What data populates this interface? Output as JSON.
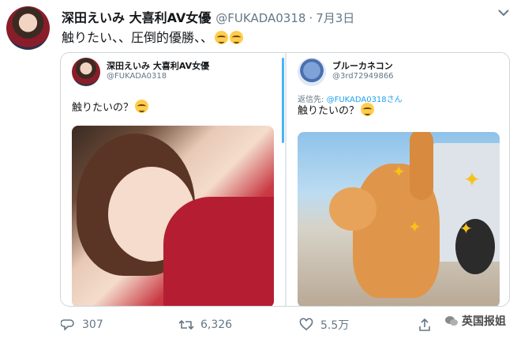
{
  "tweet": {
    "author_name": "深田えいみ 大喜利AV女優",
    "author_handle": "@FUKADA0318",
    "date": "7月3日",
    "dot": "·",
    "text": "触りたい、、圧倒的優勝、、",
    "caret_icon": "chevron-down-icon"
  },
  "quoted_left": {
    "name": "深田えいみ 大喜利AV女優",
    "handle": "@FUKADA0318",
    "text": "触りたいの？"
  },
  "quoted_right": {
    "name": "ブルーカネコン",
    "handle": "@3rd72949866",
    "reply_prefix": "返信先:",
    "reply_mention": "@FUKADA0318さん",
    "text": "触りたいの？"
  },
  "actions": {
    "reply_count": "307",
    "retweet_count": "6,326",
    "like_count": "5.5万"
  },
  "watermark": {
    "label": "英国报姐"
  },
  "colors": {
    "accent": "#1da1f2",
    "secondary_text": "#657786",
    "border": "#ccd6dd"
  }
}
